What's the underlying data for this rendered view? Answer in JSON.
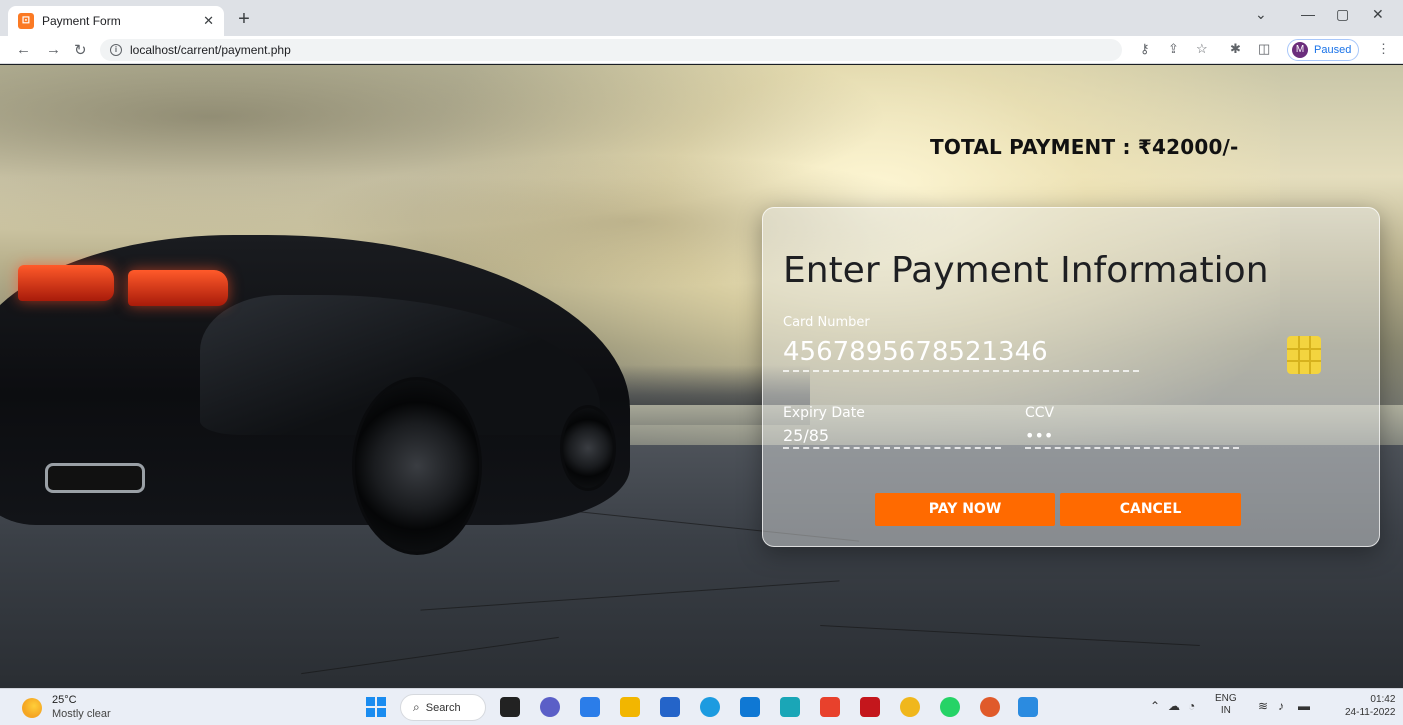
{
  "browser": {
    "tab_title": "Payment Form",
    "tab_favicon_glyph": "⊡",
    "new_tab_label": "+",
    "url": "localhost/carrent/payment.php",
    "profile_initial": "M",
    "profile_status": "Paused"
  },
  "page": {
    "total_payment": "TOTAL PAYMENT : ₹42000/-",
    "form": {
      "title": "Enter Payment Information",
      "card_number_label": "Card Number",
      "card_number_value": "4567895678521346",
      "expiry_label": "Expiry Date",
      "expiry_value": "25/85",
      "ccv_label": "CCV",
      "ccv_value": "•••",
      "pay_button": "PAY NOW",
      "cancel_button": "CANCEL"
    },
    "accent_color": "#ff6a00",
    "chip_color": "#f3d43f"
  },
  "taskbar": {
    "weather_temp": "25°C",
    "weather_desc": "Mostly clear",
    "search_label": "Search",
    "lang_line1": "ENG",
    "lang_line2": "IN",
    "time": "01:42",
    "date": "24-11-2022"
  },
  "icons": [
    "search-icon",
    "windows-start-icon",
    "back-icon",
    "forward-icon",
    "reload-icon",
    "info-icon",
    "key-icon",
    "share-icon",
    "star-icon",
    "extensions-icon",
    "sidepanel-icon",
    "menu-icon",
    "minimize-icon",
    "maximize-icon",
    "close-icon",
    "chevron-down-icon",
    "wifi-icon",
    "volume-icon",
    "battery-icon",
    "up-arrow-icon",
    "cloud-icon"
  ]
}
